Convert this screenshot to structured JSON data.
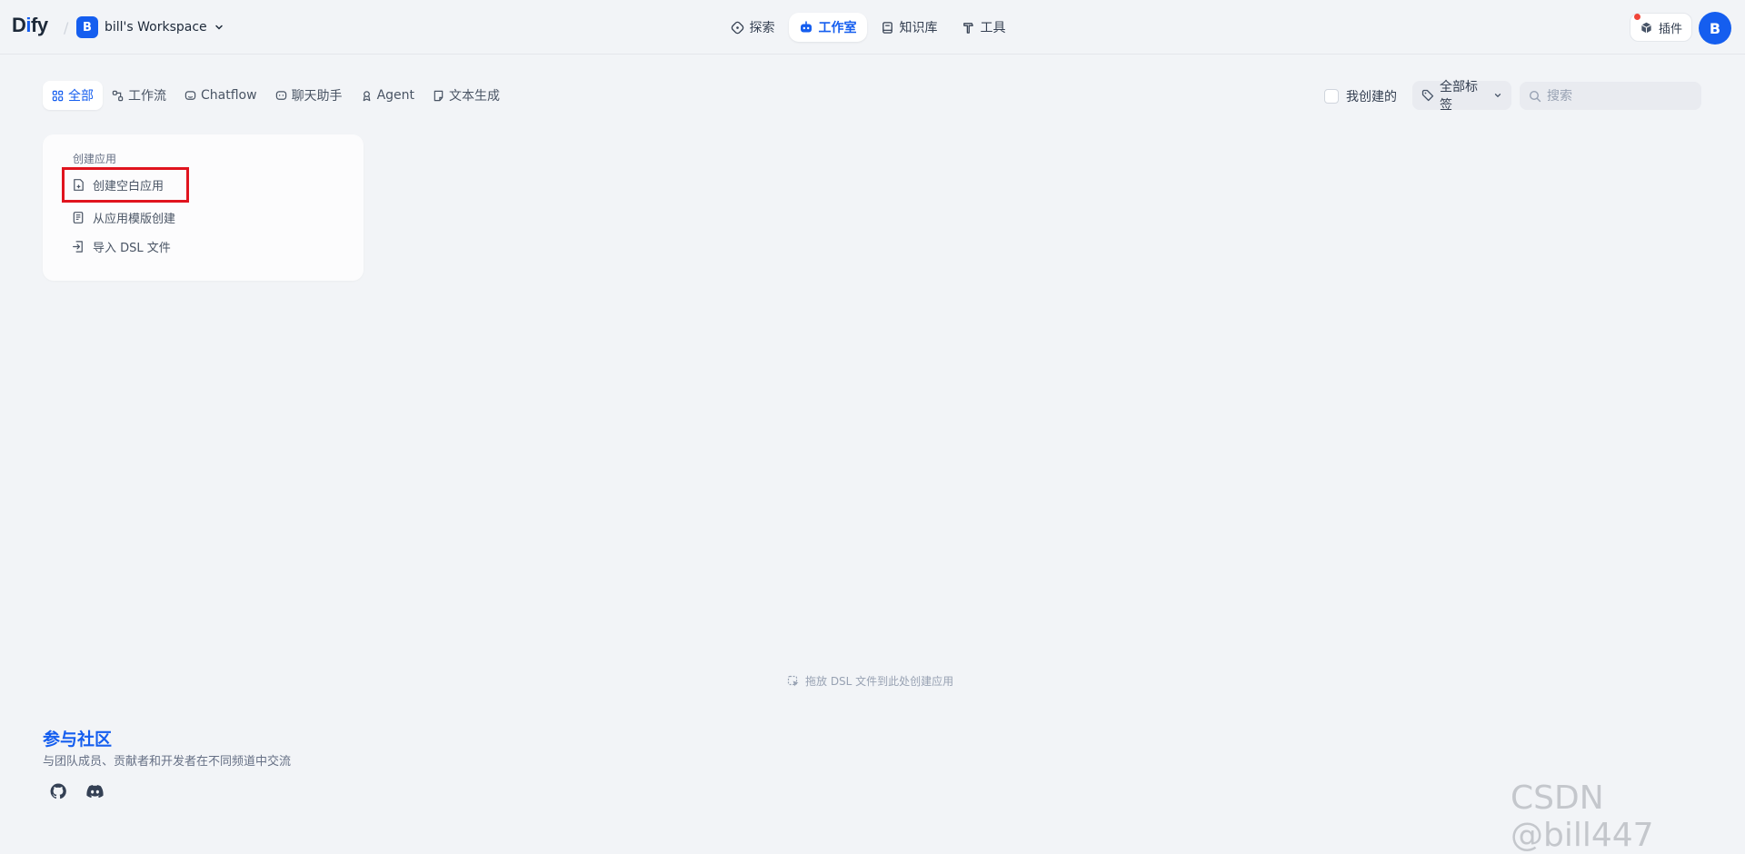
{
  "header": {
    "logo": {
      "prefix": "D",
      "i": "i",
      "suffix": "fy"
    },
    "separator": "/",
    "workspace": {
      "initial": "B",
      "name": "bill's Workspace"
    },
    "nav": [
      {
        "label": "探索",
        "icon": "compass-icon"
      },
      {
        "label": "工作室",
        "icon": "robot-icon",
        "active": true
      },
      {
        "label": "知识库",
        "icon": "book-icon"
      },
      {
        "label": "工具",
        "icon": "hammer-icon"
      }
    ],
    "plugins_label": "插件",
    "avatar_initial": "B"
  },
  "filters": {
    "tabs": [
      {
        "label": "全部",
        "icon": "grid-icon",
        "active": true
      },
      {
        "label": "工作流",
        "icon": "workflow-icon"
      },
      {
        "label": "Chatflow",
        "icon": "chatflow-icon"
      },
      {
        "label": "聊天助手",
        "icon": "chat-icon"
      },
      {
        "label": "Agent",
        "icon": "agent-icon"
      },
      {
        "label": "文本生成",
        "icon": "document-icon"
      }
    ],
    "mine_label": "我创建的",
    "tag_label": "全部标签",
    "search_placeholder": "搜索"
  },
  "create_card": {
    "title": "创建应用",
    "items": [
      {
        "label": "创建空白应用",
        "icon": "blank-file-plus-icon"
      },
      {
        "label": "从应用模版创建",
        "icon": "template-icon"
      },
      {
        "label": "导入 DSL 文件",
        "icon": "import-icon"
      }
    ]
  },
  "drop_hint": "拖放 DSL 文件到此处创建应用",
  "community": {
    "title": "参与社区",
    "subtitle": "与团队成员、贡献者和开发者在不同频道中交流",
    "links": [
      "github-icon",
      "discord-icon"
    ]
  },
  "watermark": "CSDN @bill447",
  "colors": {
    "accent": "#155eef",
    "highlight": "#e0141e",
    "background": "#f2f4f7"
  }
}
